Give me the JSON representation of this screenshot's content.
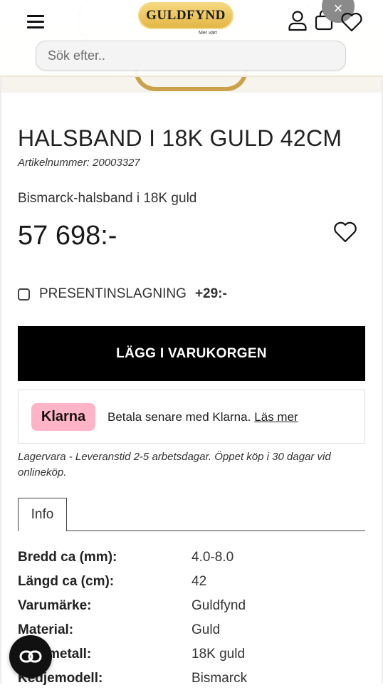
{
  "header": {
    "logo_text": "GULDFYND",
    "tagline": "Mer värt",
    "close_symbol": "×",
    "icons": [
      "menu-icon",
      "user-icon",
      "bag-icon",
      "heart-icon"
    ]
  },
  "search": {
    "placeholder": "Sök efter.."
  },
  "product": {
    "title": "HALSBAND I 18K GULD 42CM",
    "article_number": "Artikelnummer: 20003327",
    "description": "Bismarck-halsband i 18K guld",
    "price": "57 698:-"
  },
  "gift_wrap": {
    "label": "PRESENTINSLAGNING",
    "price": "+29:-",
    "checked": false
  },
  "cart_button": {
    "label": "LÄGG I VARUKORGEN"
  },
  "klarna": {
    "badge": "Klarna",
    "text": "Betala senare med Klarna.",
    "link": "Läs mer",
    "badge_color": "#ffb3c7"
  },
  "stock_note": "Lagervara - Leveranstid 2-5 arbetsdagar. Öppet köp i 30 dagar vid onlineköp.",
  "tabs": [
    {
      "label": "Info",
      "active": true
    }
  ],
  "specs": [
    {
      "key": "Bredd ca (mm):",
      "value": "4.0-8.0"
    },
    {
      "key": "Längd ca (cm):",
      "value": "42"
    },
    {
      "key": "Varumärke:",
      "value": "Guldfynd"
    },
    {
      "key": "Material:",
      "value": "Guld"
    },
    {
      "key": "metall:",
      "value": "18K guld"
    },
    {
      "key": "Kedjemodell:",
      "value": "Bismarck"
    }
  ],
  "colors": {
    "accent": "#000000",
    "gold": "#e2b543"
  }
}
